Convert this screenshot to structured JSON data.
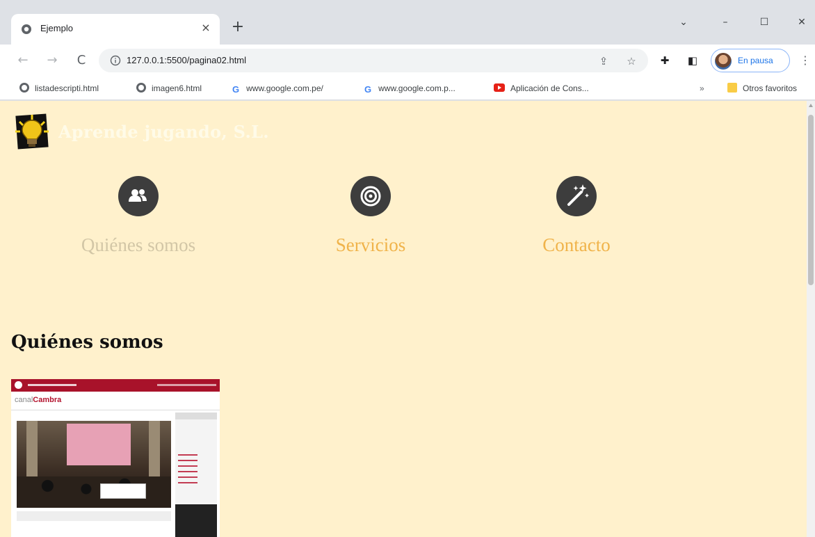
{
  "browser": {
    "tab_title": "Ejemplo",
    "tab_close": "×",
    "new_tab": "+",
    "window_controls": {
      "dropdown": "⌄",
      "minimize": "–",
      "maximize": "☐",
      "close": "✕"
    },
    "address_url": "127.0.0.1:5500/pagina02.html",
    "profile_label": "En pausa",
    "bookmarks": [
      {
        "label": "listadescripti.html",
        "icon": "globe-icon"
      },
      {
        "label": "imagen6.html",
        "icon": "globe-icon"
      },
      {
        "label": "www.google.com.pe/",
        "icon": "google-icon"
      },
      {
        "label": "www.google.com.p...",
        "icon": "google-icon"
      },
      {
        "label": "Aplicación de Cons...",
        "icon": "youtube-icon"
      }
    ],
    "bookmarks_overflow": "»",
    "other_bookmarks": "Otros favoritos"
  },
  "page": {
    "site_title": "Aprende jugando, S.L.",
    "nav": [
      {
        "label": "Quiénes somos",
        "icon": "users-icon",
        "state": "inactive"
      },
      {
        "label": "Servicios",
        "icon": "target-icon",
        "state": "active"
      },
      {
        "label": "Contacto",
        "icon": "magic-wand-icon",
        "state": "active"
      }
    ],
    "section_heading": "Quiénes somos",
    "thumbnail": {
      "brand_prefix": "canal",
      "brand_name": "Cambra"
    }
  },
  "colors": {
    "page_background": "#fff1cc",
    "nav_active": "#f0b34a",
    "nav_inactive": "#d2c6a6",
    "icon_circle": "#3d3d3d"
  }
}
